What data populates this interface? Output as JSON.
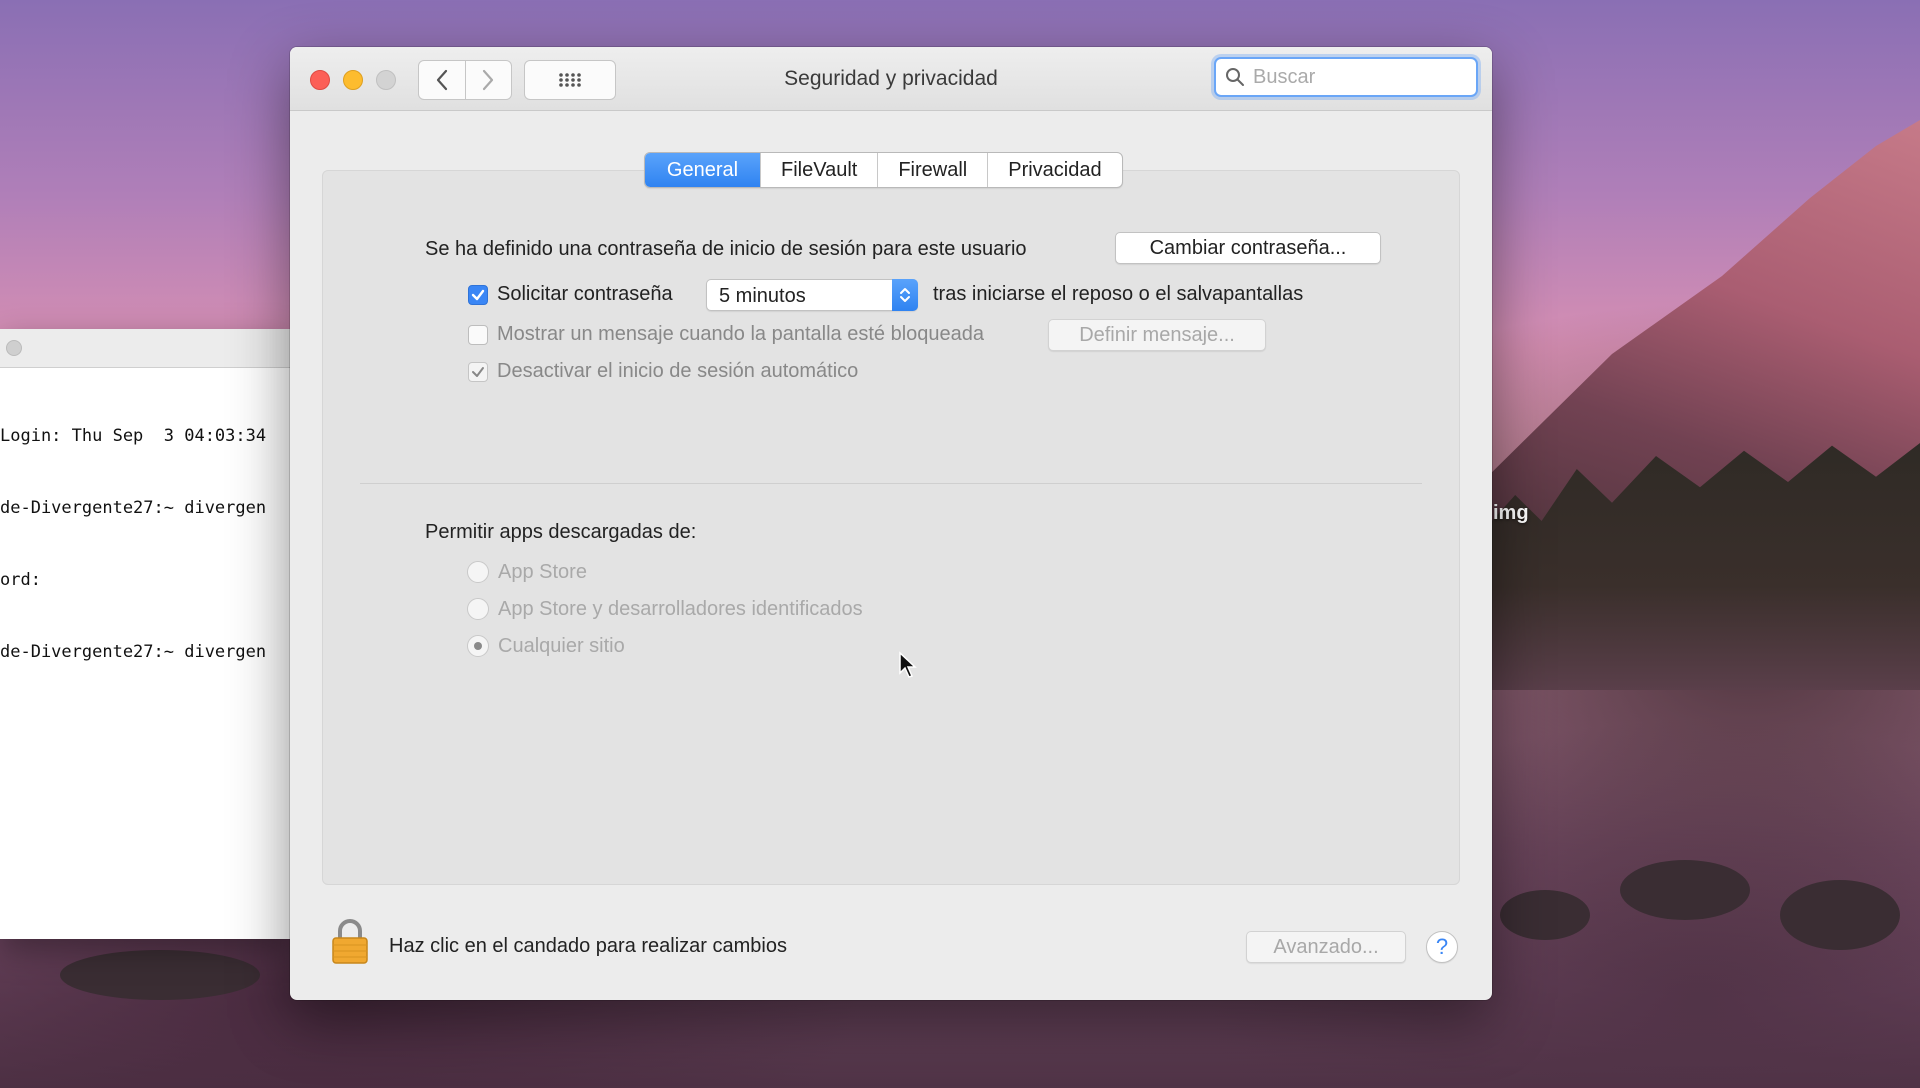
{
  "desktop": {
    "label": "img"
  },
  "terminal": {
    "lines": [
      "Login: Thu Sep  3 04:03:34",
      "de-Divergente27:~ divergen",
      "ord:",
      "de-Divergente27:~ divergen"
    ]
  },
  "window": {
    "title": "Seguridad y privacidad",
    "search": {
      "placeholder": "Buscar",
      "value": ""
    },
    "tabs": [
      {
        "label": "General",
        "active": true
      },
      {
        "label": "FileVault",
        "active": false
      },
      {
        "label": "Firewall",
        "active": false
      },
      {
        "label": "Privacidad",
        "active": false
      }
    ],
    "general": {
      "password_set_text": "Se ha definido una contraseña de inicio de sesión para este usuario",
      "change_password_button": "Cambiar contraseña...",
      "require_password": {
        "label": "Solicitar contraseña",
        "checked": true,
        "delay_value": "5 minutos",
        "suffix": "tras iniciarse el reposo o el salvapantallas"
      },
      "show_message": {
        "label": "Mostrar un mensaje cuando la pantalla esté bloqueada",
        "checked": false,
        "button": "Definir mensaje..."
      },
      "disable_auto_login": {
        "label": "Desactivar el inicio de sesión automático",
        "checked": true
      },
      "allow_apps": {
        "label": "Permitir apps descargadas de:",
        "options": [
          {
            "label": "App Store",
            "selected": false
          },
          {
            "label": "App Store y desarrolladores identificados",
            "selected": false
          },
          {
            "label": "Cualquier sitio",
            "selected": true
          }
        ]
      }
    },
    "footer": {
      "lock_text": "Haz clic en el candado para realizar cambios",
      "advanced_button": "Avanzado...",
      "help_label": "?"
    }
  },
  "colors": {
    "accent": "#3a86f5",
    "close": "#fc5f57",
    "minimize": "#fdbc2e",
    "lock": "#f0a830"
  }
}
